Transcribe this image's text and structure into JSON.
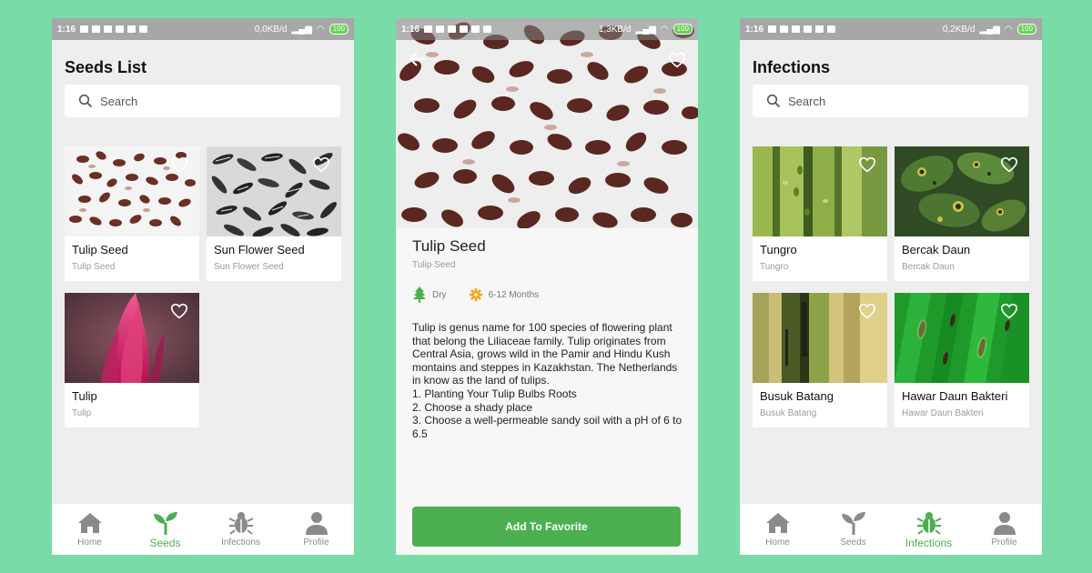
{
  "colors": {
    "background": "#79dba7",
    "accent": "#4caf50",
    "screen_bg": "#eeeeee"
  },
  "status_bars": [
    {
      "time": "1:16",
      "speed": "0,0KB/d",
      "battery": "100"
    },
    {
      "time": "1:16",
      "speed": "1,3KB/d",
      "battery": "100"
    },
    {
      "time": "1:16",
      "speed": "0,2KB/d",
      "battery": "100"
    }
  ],
  "seeds_screen": {
    "title": "Seeds List",
    "search_placeholder": "Search",
    "items": [
      {
        "name": "Tulip Seed",
        "subtitle": "Tulip Seed",
        "image": "tulip-seed-image"
      },
      {
        "name": "Sun Flower Seed",
        "subtitle": "Sun Flower Seed",
        "image": "sunflower-seed-image"
      },
      {
        "name": "Tulip",
        "subtitle": "Tulip",
        "image": "tulip-flower-image"
      }
    ]
  },
  "detail_screen": {
    "title": "Tulip Seed",
    "subtitle": "Tulip Seed",
    "condition": "Dry",
    "duration": "6-12 Months",
    "description": [
      "Tulip is genus name for 100 species of flowering plant that belong the Liliaceae family. Tulip originates from Central Asia, grows wild in the Pamir and Hindu Kush montains and steppes in Kazakhstan. The Netherlands in know as the land of tulips.",
      "1. Planting Your Tulip Bulbs Roots",
      "2. Choose a shady place",
      "3. Choose a well-permeable sandy soil with a pH of 6 to 6.5"
    ],
    "button_label": "Add To Favorite"
  },
  "infections_screen": {
    "title": "Infections",
    "search_placeholder": "Search",
    "items": [
      {
        "name": "Tungro",
        "subtitle": "Tungro",
        "image": "tungro-image"
      },
      {
        "name": "Bercak Daun",
        "subtitle": "Bercak Daun",
        "image": "bercak-daun-image"
      },
      {
        "name": "Busuk Batang",
        "subtitle": "Busuk Batang",
        "image": "busuk-batang-image"
      },
      {
        "name": "Hawar Daun Bakteri",
        "subtitle": "Hawar Daun Bakteri",
        "image": "hawar-daun-bakteri-image"
      }
    ]
  },
  "nav": {
    "items": [
      {
        "label": "Home",
        "icon": "home-icon"
      },
      {
        "label": "Seeds",
        "icon": "sprout-icon"
      },
      {
        "label": "Infections",
        "icon": "bug-icon"
      },
      {
        "label": "Profile",
        "icon": "person-icon"
      }
    ]
  }
}
